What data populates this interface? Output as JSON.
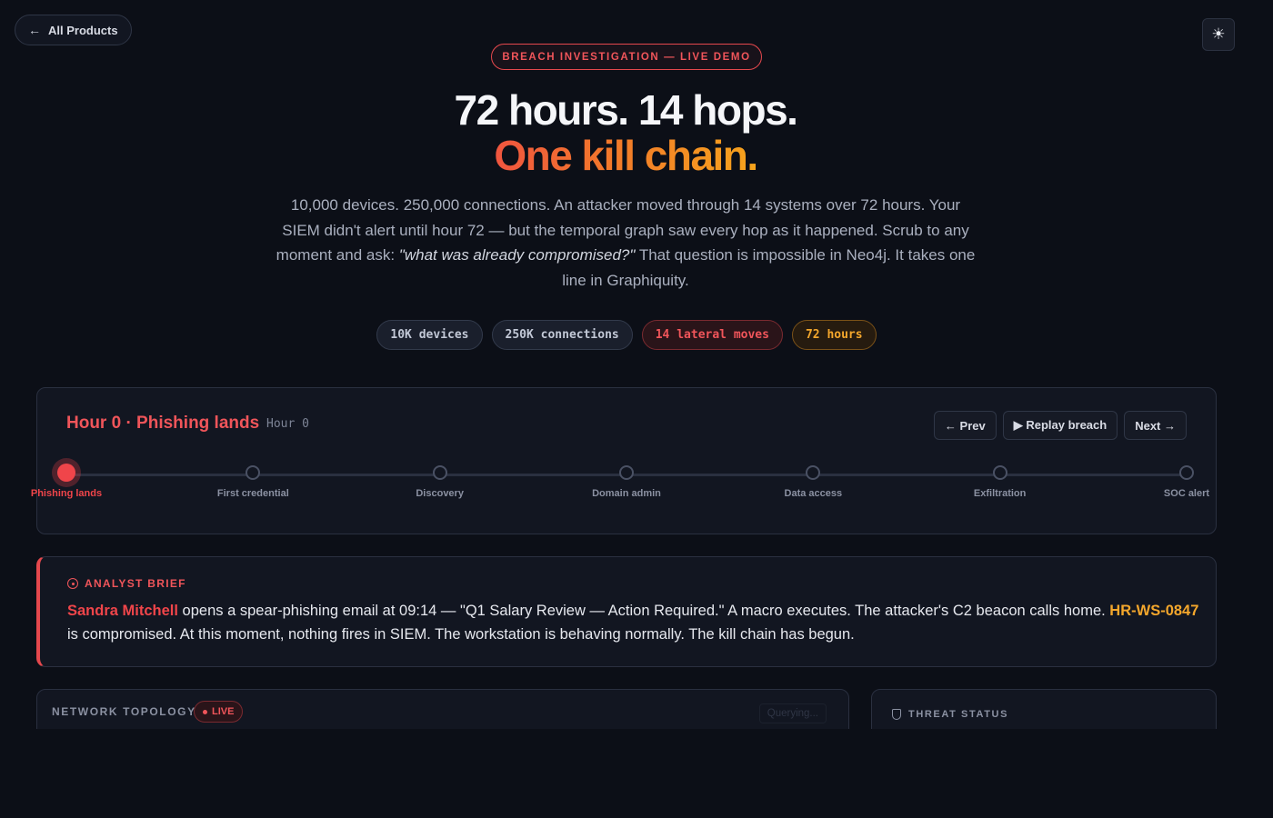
{
  "nav": {
    "back_label": "All Products",
    "theme_icon": "sun-icon"
  },
  "hero": {
    "tag": "BREACH INVESTIGATION — LIVE DEMO",
    "headline_line1": "72 hours. 14 hops.",
    "headline_line2": "One kill chain.",
    "sub_part1": "10,000 devices. 250,000 connections. An attacker moved through 14 systems over 72 hours. Your SIEM didn't alert until hour 72 — but the temporal graph saw every hop as it happened. Scrub to any moment and ask: ",
    "sub_quote": "\"what was already compromised?\"",
    "sub_part2": " That question is impossible in Neo4j. It takes one line in Graphiquity.",
    "pills": [
      {
        "label": "10K devices",
        "tone": "neutral"
      },
      {
        "label": "250K connections",
        "tone": "neutral"
      },
      {
        "label": "14 lateral moves",
        "tone": "red"
      },
      {
        "label": "72 hours",
        "tone": "orange"
      }
    ]
  },
  "timeline": {
    "title": "Hour 0 · Phishing lands",
    "subtitle": "Hour 0",
    "prev_label": "← Prev",
    "replay_label": "▶ Replay breach",
    "next_label": "Next →",
    "active_index": 0,
    "steps": [
      "Phishing lands",
      "First credential",
      "Discovery",
      "Domain admin",
      "Data access",
      "Exfiltration",
      "SOC alert"
    ]
  },
  "brief": {
    "heading": "ANALYST BRIEF",
    "person": "Sandra Mitchell",
    "text_a": " opens a spear-phishing email at 09:14 — \"Q1 Salary Review — Action Required.\" A macro executes. The attacker's C2 beacon calls home. ",
    "host": "HR-WS-0847",
    "text_b": " is compromised. At this moment, nothing fires in SIEM. The workstation is behaving normally. The kill chain has begun."
  },
  "topology": {
    "label": "NETWORK TOPOLOGY",
    "live_label": "LIVE",
    "status": "Querying..."
  },
  "threat": {
    "label": "THREAT STATUS"
  },
  "colors": {
    "accent_red": "#f0454a",
    "accent_orange": "#f4a72c",
    "background": "#0c0f17"
  }
}
